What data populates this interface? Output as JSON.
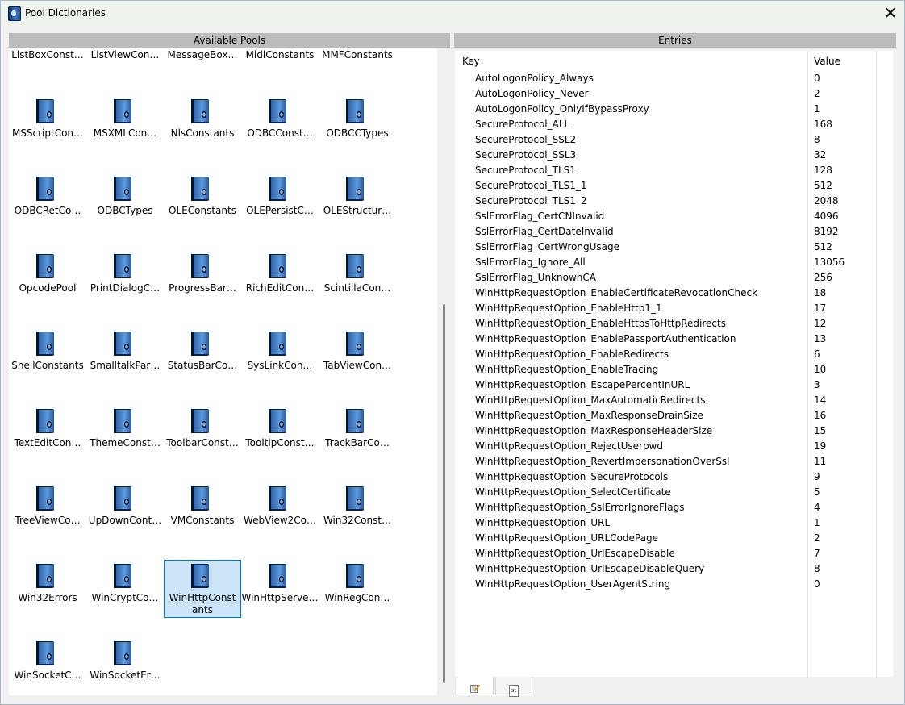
{
  "window": {
    "title": "Pool Dictionaries",
    "close_glyph": "✕"
  },
  "left_panel": {
    "header": "Available Pools",
    "partial_row": [
      "ListBoxConst…",
      "ListViewCon…",
      "MessageBox…",
      "MidiConstants",
      "MMFConstants"
    ],
    "pools": [
      "MSScriptCon…",
      "MSXMLCon…",
      "NlsConstants",
      "ODBCConst…",
      "ODBCCTypes",
      "ODBCRetCo…",
      "ODBCTypes",
      "OLEConstants",
      "OLEPersistC…",
      "OLEStructur…",
      "OpcodePool",
      "PrintDialogC…",
      "ProgressBar…",
      "RichEditCon…",
      "ScintillaCon…",
      "ShellConstants",
      "SmalltalkPar…",
      "StatusBarCo…",
      "SysLinkCon…",
      "TabViewCon…",
      "TextEditCon…",
      "ThemeConst…",
      "ToolbarConst…",
      "TooltipConst…",
      "TrackBarCo…",
      "TreeViewCo…",
      "UpDownCont…",
      "VMConstants",
      "WebView2Co…",
      "Win32Const…",
      "Win32Errors",
      "WinCryptCo…",
      "WinHttpConstants",
      "WinHttpServe…",
      "WinRegCon…",
      "WinSocketC…",
      "WinSocketEr…"
    ],
    "selected_pool": "WinHttpConstants",
    "icon": "pool-book-icon"
  },
  "right_panel": {
    "header": "Entries",
    "columns": {
      "key": "Key",
      "value": "Value"
    },
    "entries": [
      {
        "key": "AutoLogonPolicy_Always",
        "value": "0"
      },
      {
        "key": "AutoLogonPolicy_Never",
        "value": "2"
      },
      {
        "key": "AutoLogonPolicy_OnlyIfBypassProxy",
        "value": "1"
      },
      {
        "key": "SecureProtocol_ALL",
        "value": "168"
      },
      {
        "key": "SecureProtocol_SSL2",
        "value": "8"
      },
      {
        "key": "SecureProtocol_SSL3",
        "value": "32"
      },
      {
        "key": "SecureProtocol_TLS1",
        "value": "128"
      },
      {
        "key": "SecureProtocol_TLS1_1",
        "value": "512"
      },
      {
        "key": "SecureProtocol_TLS1_2",
        "value": "2048"
      },
      {
        "key": "SslErrorFlag_CertCNInvalid",
        "value": "4096"
      },
      {
        "key": "SslErrorFlag_CertDateInvalid",
        "value": "8192"
      },
      {
        "key": "SslErrorFlag_CertWrongUsage",
        "value": "512"
      },
      {
        "key": "SslErrorFlag_Ignore_All",
        "value": "13056"
      },
      {
        "key": "SslErrorFlag_UnknownCA",
        "value": "256"
      },
      {
        "key": "WinHttpRequestOption_EnableCertificateRevocationCheck",
        "value": "18"
      },
      {
        "key": "WinHttpRequestOption_EnableHttp1_1",
        "value": "17"
      },
      {
        "key": "WinHttpRequestOption_EnableHttpsToHttpRedirects",
        "value": "12"
      },
      {
        "key": "WinHttpRequestOption_EnablePassportAuthentication",
        "value": "13"
      },
      {
        "key": "WinHttpRequestOption_EnableRedirects",
        "value": "6"
      },
      {
        "key": "WinHttpRequestOption_EnableTracing",
        "value": "10"
      },
      {
        "key": "WinHttpRequestOption_EscapePercentInURL",
        "value": "3"
      },
      {
        "key": "WinHttpRequestOption_MaxAutomaticRedirects",
        "value": "14"
      },
      {
        "key": "WinHttpRequestOption_MaxResponseDrainSize",
        "value": "16"
      },
      {
        "key": "WinHttpRequestOption_MaxResponseHeaderSize",
        "value": "15"
      },
      {
        "key": "WinHttpRequestOption_RejectUserpwd",
        "value": "19"
      },
      {
        "key": "WinHttpRequestOption_RevertImpersonationOverSsl",
        "value": "11"
      },
      {
        "key": "WinHttpRequestOption_SecureProtocols",
        "value": "9"
      },
      {
        "key": "WinHttpRequestOption_SelectCertificate",
        "value": "5"
      },
      {
        "key": "WinHttpRequestOption_SslErrorIgnoreFlags",
        "value": "4"
      },
      {
        "key": "WinHttpRequestOption_URL",
        "value": "1"
      },
      {
        "key": "WinHttpRequestOption_URLCodePage",
        "value": "2"
      },
      {
        "key": "WinHttpRequestOption_UrlEscapeDisable",
        "value": "7"
      },
      {
        "key": "WinHttpRequestOption_UrlEscapeDisableQuery",
        "value": "8"
      },
      {
        "key": "WinHttpRequestOption_UserAgentString",
        "value": "0"
      }
    ]
  },
  "tabs": [
    {
      "icon": "edit-icon",
      "label": ""
    },
    {
      "icon": "source-icon",
      "label": "st"
    }
  ],
  "colors": {
    "header_bg": "#bcbcbc",
    "selection_bg": "#cce4f7",
    "selection_border": "#0078d7"
  }
}
